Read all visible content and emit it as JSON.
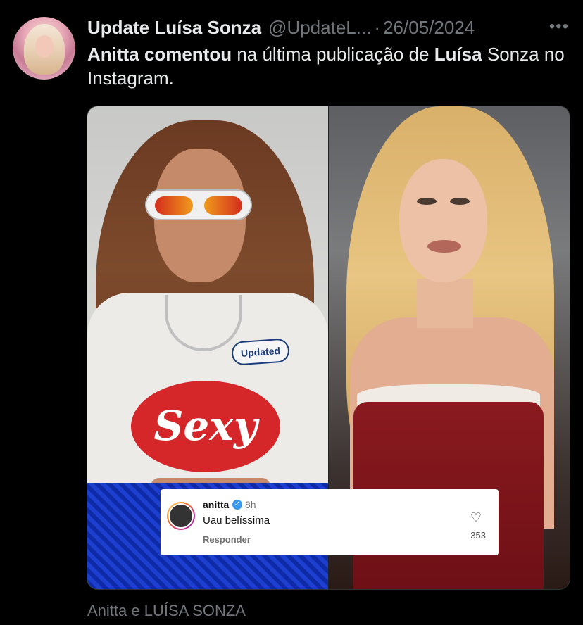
{
  "post": {
    "display_name": "Update Luísa Sonza",
    "handle": "@UpdateL...",
    "separator": "·",
    "date": "26/05/2024",
    "more_icon": "more-horizontal-icon",
    "more_label": "•••",
    "text_part1_bold": "Anitta comentou",
    "text_part2": " na última publicação de ",
    "text_part3_bold": "Luísa",
    "text_part4": " Sonza no Instagram."
  },
  "media": {
    "left_tee_text": "Sexy",
    "left_badge_text": "Updated"
  },
  "comment": {
    "username": "anitta",
    "verified_icon": "verified-badge-icon",
    "verified_glyph": "✓",
    "time": "8h",
    "text": "Uau belíssima",
    "reply_label": "Responder",
    "heart_icon": "heart-icon",
    "heart_glyph": "♡",
    "likes": "353"
  },
  "caption": "Anitta e LUÍSA SONZA",
  "colors": {
    "background": "#000000",
    "text_primary": "#e7e9ea",
    "text_secondary": "#71767b",
    "instagram_verified": "#3897f0"
  }
}
